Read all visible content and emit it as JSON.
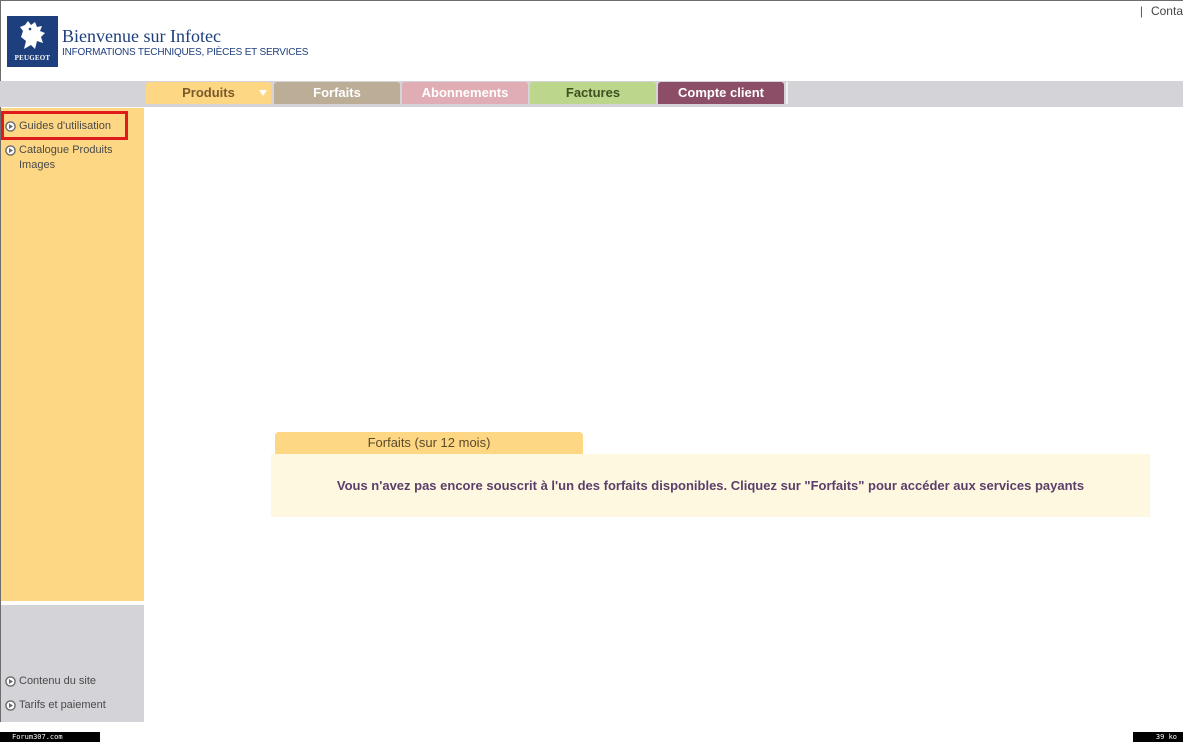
{
  "header": {
    "top_link": "Conta",
    "separator": "|",
    "logo_brand": "PEUGEOT",
    "title": "Bienvenue sur Infotec",
    "subtitle": "INFORMATIONS TECHNIQUES, PIÈCES ET SERVICES"
  },
  "nav": {
    "tabs": [
      {
        "label": "Produits",
        "color": "#fed785"
      },
      {
        "label": "Forfaits",
        "color": "#bcad96"
      },
      {
        "label": "Abonnements",
        "color": "#dfadb3"
      },
      {
        "label": "Factures",
        "color": "#bcd78b"
      },
      {
        "label": "Compte client",
        "color": "#8c4d66"
      }
    ]
  },
  "sidebar": {
    "items": [
      {
        "label": "Guides d'utilisation",
        "icon": "circle-arrow-icon"
      },
      {
        "label": "Catalogue Produits Images",
        "icon": "circle-arrow-icon"
      }
    ],
    "bottom_items": [
      {
        "label": "Contenu du site",
        "icon": "circle-arrow-icon"
      },
      {
        "label": "Tarifs et paiement",
        "icon": "circle-arrow-icon"
      }
    ]
  },
  "main": {
    "card_title": "Forfaits (sur 12 mois)",
    "card_message": "Vous n'avez pas encore souscrit à l'un des forfaits disponibles. Cliquez sur \"Forfaits\" pour accéder aux services payants"
  },
  "footer": {
    "left_text": "Forum307.com",
    "right_text": "39 ko"
  },
  "colors": {
    "brand_blue": "#1d3f7e",
    "sidebar_yellow": "#fed785",
    "highlight_red": "#e11b1b"
  }
}
